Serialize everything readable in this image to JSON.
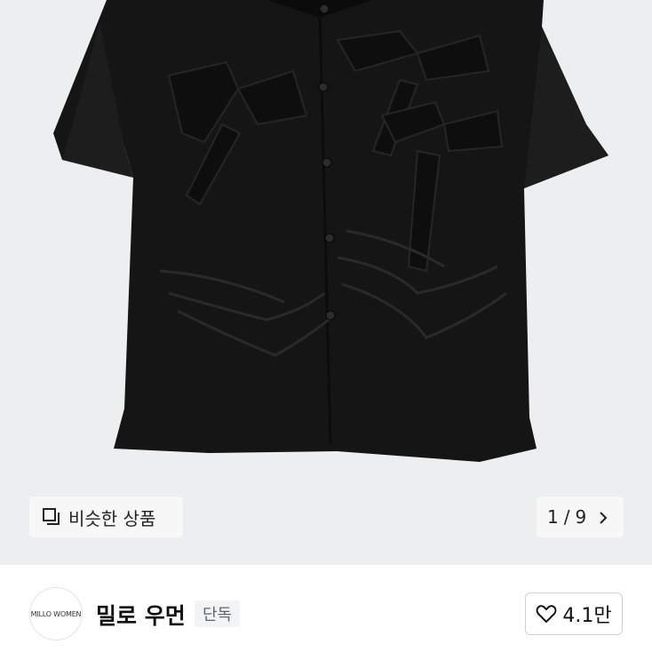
{
  "product": {
    "image_alt": "black short-sleeve shirt with bow details",
    "similar_label": "비슷한 상품",
    "similar_icon": "similar-items-icon",
    "pager": {
      "current": "1",
      "separator": "/",
      "total": "9",
      "icon": "chevron-right-icon"
    }
  },
  "brand": {
    "logo_text": "MILLO WOMEN",
    "name": "밀로 우먼",
    "badge": "단독",
    "like_icon": "heart-outline-icon",
    "like_count": "4.1만"
  },
  "colors": {
    "image_bg": "#edeef0",
    "garment": "#151515",
    "chip_bg": "#f7f7f8",
    "badge_bg": "#f2f3f5"
  }
}
